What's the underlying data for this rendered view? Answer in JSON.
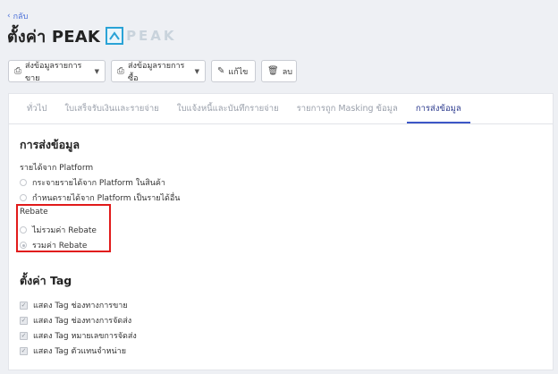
{
  "back": {
    "label": "กลับ"
  },
  "page": {
    "title": "ตั้งค่า PEAK",
    "logo_text": "PEAK"
  },
  "toolbar": {
    "sales_label": "ส่งข้อมูลรายการขาย",
    "purchase_label": "ส่งข้อมูลรายการซื้อ",
    "edit_label": "แก้ไข",
    "delete_label": "ลบ"
  },
  "tabs": [
    {
      "label": "ทั่วไป"
    },
    {
      "label": "ใบเสร็จรับเงินและรายจ่าย"
    },
    {
      "label": "ใบแจ้งหนี้และบันทึกรายจ่าย"
    },
    {
      "label": "รายการถูก Masking ข้อมูล"
    },
    {
      "label": "การส่งข้อมูล"
    }
  ],
  "data_sending": {
    "title": "การส่งข้อมูล",
    "platform_income": {
      "label": "รายได้จาก Platform",
      "options": [
        {
          "label": "กระจายรายได้จาก Platform ในสินค้า"
        },
        {
          "label": "กำหนดรายได้จาก Platform เป็นรายได้อื่น"
        }
      ]
    },
    "rebate": {
      "label": "Rebate",
      "options": [
        {
          "label": "ไม่รวมค่า Rebate"
        },
        {
          "label": "รวมค่า Rebate"
        }
      ],
      "selected": "รวมค่า Rebate"
    }
  },
  "tag_settings": {
    "title": "ตั้งค่า Tag",
    "items": [
      {
        "label": "แสดง Tag ช่องทางการขาย",
        "checked": true
      },
      {
        "label": "แสดง Tag ช่องทางการจัดส่ง",
        "checked": true
      },
      {
        "label": "แสดง Tag หมายเลขการจัดส่ง",
        "checked": true
      },
      {
        "label": "แสดง Tag ตัวแทนจำหน่าย",
        "checked": true
      }
    ]
  },
  "colors": {
    "accent": "#3d57c7",
    "highlight": "#e11b1b",
    "logo": "#2aa3d6"
  }
}
